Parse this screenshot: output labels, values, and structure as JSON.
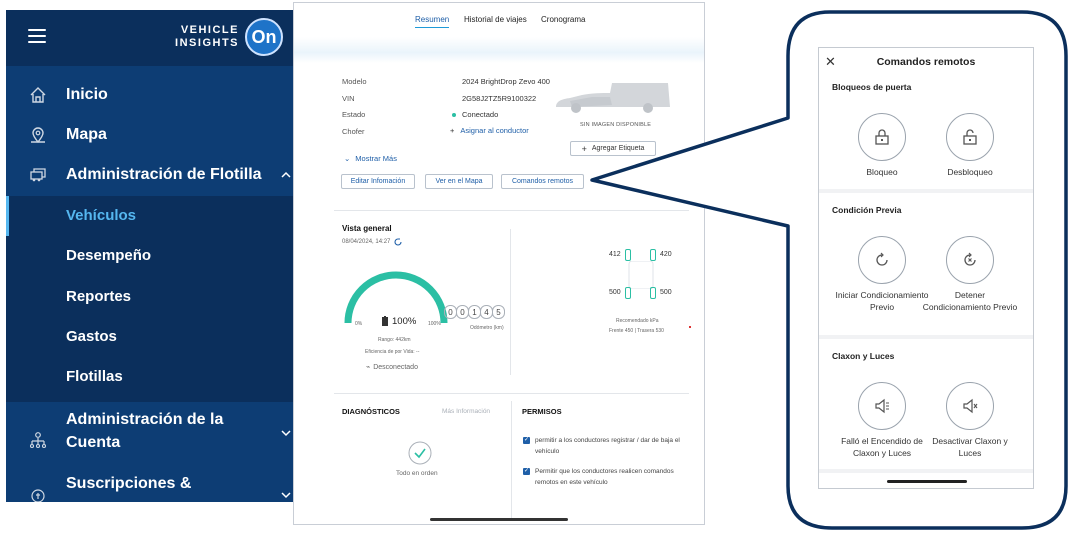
{
  "sidebar": {
    "brand_line1": "VEHICLE",
    "brand_line2": "INSIGHTS",
    "brand_badge": "On",
    "items": [
      {
        "label": "Inicio",
        "icon": "home-icon"
      },
      {
        "label": "Mapa",
        "icon": "map-pin-icon"
      },
      {
        "label": "Administración de Flotilla",
        "icon": "fleet-icon"
      },
      {
        "label": "Administración de la Cuenta",
        "icon": "account-icon"
      },
      {
        "label": "Suscripciones &",
        "icon": "subscriptions-icon"
      }
    ],
    "subitems": [
      {
        "label": "Vehículos",
        "active": true
      },
      {
        "label": "Desempeño"
      },
      {
        "label": "Reportes"
      },
      {
        "label": "Gastos"
      },
      {
        "label": "Flotillas"
      }
    ],
    "colors": {
      "background": "#0d3d74",
      "accent": "#55b7f0"
    }
  },
  "tabs": [
    "Resumen",
    "Historial de viajes",
    "Cronograma"
  ],
  "vehicle": {
    "model_label": "Modelo",
    "model_value": "2024 BrightDrop Zevo 400",
    "vin_label": "VIN",
    "vin_value": "2G58J2TZ5R9100322",
    "state_label": "Estado",
    "state_value": "Conectado",
    "driver_label": "Chofer",
    "driver_value": "Asignar al conductor",
    "image_caption": "SIN IMAGEN DISPONIBLE",
    "more": "Mostrar Más",
    "tag_button": "Agregar Etiqueta"
  },
  "actions": [
    "Editar Infomación",
    "Ver en el Mapa",
    "Comandos remotos"
  ],
  "overview": {
    "title": "Vista general",
    "timestamp": "08/04/2024, 14:27",
    "gauge_min": "0%",
    "gauge_max": "100%",
    "battery": "100%",
    "battery_level": 1.0,
    "range": "Rango: 442km",
    "efficiency": "Eficiencia de por Vida: --",
    "odometer_digits": [
      "0",
      "0",
      "1",
      "4",
      "5"
    ],
    "odometer_label": "Odómetro (km)",
    "status": "Desconectado",
    "tires": {
      "fl": "412",
      "fr": "420",
      "rl": "500",
      "rr": "500"
    },
    "tire_note1": "Recomendado kPa",
    "tire_note2": "Frente 450 | Trasera 530"
  },
  "diagnostics": {
    "title": "DIAGNÓSTICOS",
    "more": "Más Información",
    "status": "Todo en orden"
  },
  "permissions": {
    "title": "PERMISOS",
    "items": [
      "permitir a los conductores registrar / dar de baja el vehículo",
      "Permitir que los conductores realicen comandos remotos en este vehículo"
    ]
  },
  "modal": {
    "title": "Comandos remotos",
    "sections": [
      {
        "title": "Bloqueos de puerta",
        "commands": [
          {
            "label": "Bloqueo",
            "icon": "lock-icon"
          },
          {
            "label": "Desbloqueo",
            "icon": "unlock-icon"
          }
        ]
      },
      {
        "title": "Condición Previa",
        "commands": [
          {
            "label": "Iniciar Condicionamiento Previo",
            "icon": "start-precondition-icon"
          },
          {
            "label": "Detener Condicionamiento Previo",
            "icon": "stop-precondition-icon"
          }
        ]
      },
      {
        "title": "Claxon y Luces",
        "commands": [
          {
            "label": "Falló el Encendido de Claxon y Luces",
            "icon": "horn-lights-icon"
          },
          {
            "label": "Desactivar Claxon y Luces",
            "icon": "horn-lights-off-icon"
          }
        ]
      }
    ],
    "callout_border_color": "#0b2f5c"
  }
}
